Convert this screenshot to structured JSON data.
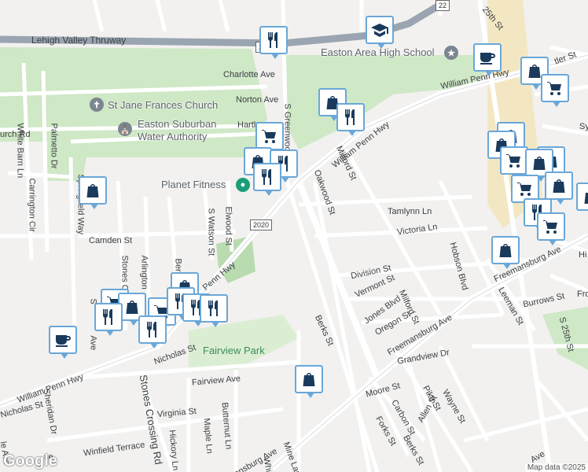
{
  "roads": {
    "lehigh_valley_thruway": "Lehigh Valley Thruway",
    "william_penn_hwy_ne": "William Penn Hwy",
    "william_penn_hwy_mid": "William Penn Hwy",
    "william_penn_hwy_sw": "William Penn Hwy",
    "penn_hwy_fragment": "Penn Hwy",
    "charlotte_ave": "Charlotte Ave",
    "norton_ave": "Norton Ave",
    "hartley_fragment": "Hartl",
    "church_rd": "urch Rd",
    "white_barn_ln": "White Barn Ln",
    "palmetto_dr": "Palmetto Dr",
    "carrington_cir": "Carrington Cir",
    "springfield_way": "Springfield Way",
    "camden_st": "Camden St",
    "stones_c": "Stones C",
    "arlington": "Arlington",
    "berkley": "Berkle",
    "s_watson_st": "S Watson St",
    "elwood_st": "Elwood St",
    "s_greenwood": "S Greenwood",
    "oakwood_st": "Oakwood St",
    "milford_st_n": "Milford St",
    "milford_st_s": "Milford St",
    "tamlynn_ln": "Tamlynn Ln",
    "victoria_ln": "Victoria Ln",
    "division_st": "Division St",
    "vermont_st": "Vermont St",
    "jones_blvd": "Jones Blvd",
    "oregon_st": "Oregon St",
    "berks_st": "Berks St",
    "hobson_blvd": "Hobson Blvd",
    "freemansburg_ave_e": "Freemansburg Ave",
    "freemansburg_ave_w": "Freemansburg Ave",
    "ansburg_ave": "ansburg Ave",
    "leeman_st": "Leeman St",
    "burrows_st": "Burrows St",
    "s_25th_st_s": "S 25th St",
    "s_25th_st_n": "S 25th St",
    "nicholas_st_w": "Nicholas St",
    "nicholas_st_e": "Nicholas St",
    "fairview_ave": "Fairview Ave",
    "virginia_st": "Virginia St",
    "butternut_ln": "Butternut Ln",
    "maple_ln": "Maple Ln",
    "hickory_ln": "Hickory Ln",
    "stones_crossing_rd": "Stones Crossing Rd",
    "winfield_terrace": "Winfield Terrace",
    "mine_lane": "Mine Lan",
    "whit": "Whit",
    "grandview_dr": "Grandview Dr",
    "moore_st": "Moore St",
    "pike_st": "Pike St",
    "carbon_st": "Carbon St",
    "forks_st": "Forks St",
    "berks_st_s": "Berks St",
    "allen_st": "Allen St",
    "wayne_st": "Wayne St",
    "sheridan_dr": "Sheridan Dr",
    "ave_fragment_1": "Ave",
    "ave_fragment_2": "Ave",
    "s_fragment": "S",
    "le_ave": "le Ave",
    "se_fragment": "se",
    "sy_fragment": "Sy",
    "fro_fragment": "Fro",
    "hi_fragment": "Hi",
    "tler_fragment": "tler St",
    "s_25th_top": "25th St",
    "route_2020": "2020",
    "route_22": "22",
    "route_shield": "22"
  },
  "places": {
    "easton_hs": "Easton Area High School",
    "st_jane": "St Jane Frances Church",
    "water_auth_1": "Easton Suburban",
    "water_auth_2": "Water Authority",
    "planet_fitness": "Planet Fitness",
    "fairview_park": "Fairview Park"
  },
  "markers": [
    {
      "name": "restaurant-marker-1",
      "icon": "restaurant-icon"
    },
    {
      "name": "school-marker",
      "icon": "school-icon"
    },
    {
      "name": "cafe-marker-1",
      "icon": "cafe-icon"
    },
    {
      "name": "shopping-marker-1",
      "icon": "shopping-bag-icon"
    },
    {
      "name": "cart-marker-1",
      "icon": "shopping-cart-icon"
    },
    {
      "name": "shopping-marker-2",
      "icon": "shopping-bag-icon"
    },
    {
      "name": "restaurant-marker-2",
      "icon": "restaurant-icon"
    },
    {
      "name": "cart-marker-2",
      "icon": "shopping-cart-icon"
    },
    {
      "name": "shopping-marker-3",
      "icon": "shopping-bag-icon"
    },
    {
      "name": "restaurant-marker-3",
      "icon": "restaurant-icon"
    },
    {
      "name": "restaurant-marker-4",
      "icon": "restaurant-icon"
    },
    {
      "name": "shopping-marker-4",
      "icon": "shopping-bag-icon"
    },
    {
      "name": "shopping-marker-5",
      "icon": "shopping-bag-icon"
    },
    {
      "name": "shopping-marker-6",
      "icon": "shopping-bag-icon"
    },
    {
      "name": "cart-marker-3",
      "icon": "shopping-cart-icon"
    },
    {
      "name": "shopping-marker-7",
      "icon": "shopping-bag-icon"
    },
    {
      "name": "shopping-marker-8",
      "icon": "shopping-bag-icon"
    },
    {
      "name": "cart-marker-4",
      "icon": "shopping-cart-icon"
    },
    {
      "name": "restaurant-marker-5",
      "icon": "restaurant-icon"
    },
    {
      "name": "cart-marker-5",
      "icon": "shopping-cart-icon"
    },
    {
      "name": "shopping-marker-9",
      "icon": "shopping-bag-icon"
    },
    {
      "name": "shopping-marker-10",
      "icon": "shopping-bag-icon"
    },
    {
      "name": "cart-marker-6",
      "icon": "shopping-cart-icon"
    },
    {
      "name": "shopping-marker-11",
      "icon": "shopping-bag-icon"
    },
    {
      "name": "restaurant-marker-6",
      "icon": "restaurant-icon"
    },
    {
      "name": "shopping-marker-12",
      "icon": "shopping-bag-icon"
    },
    {
      "name": "cart-marker-7",
      "icon": "shopping-cart-icon"
    },
    {
      "name": "shopping-marker-13",
      "icon": "shopping-bag-icon"
    },
    {
      "name": "restaurant-marker-7",
      "icon": "restaurant-icon"
    },
    {
      "name": "restaurant-marker-8",
      "icon": "restaurant-icon"
    },
    {
      "name": "restaurant-marker-9",
      "icon": "restaurant-icon"
    },
    {
      "name": "restaurant-marker-10",
      "icon": "restaurant-icon"
    },
    {
      "name": "cafe-marker-2",
      "icon": "cafe-icon"
    },
    {
      "name": "shopping-marker-14",
      "icon": "shopping-bag-icon"
    },
    {
      "name": "shopping-marker-15",
      "icon": "shopping-bag-icon"
    }
  ],
  "footer": {
    "google": "Google",
    "attribution": "Map data ©2025"
  },
  "colors": {
    "marker_border": "#6aa7d8",
    "marker_icon": "#1a3a5c",
    "park": "#cfe8c6",
    "highway": "#9aa5b1",
    "commercial": "#f3e7c3"
  }
}
